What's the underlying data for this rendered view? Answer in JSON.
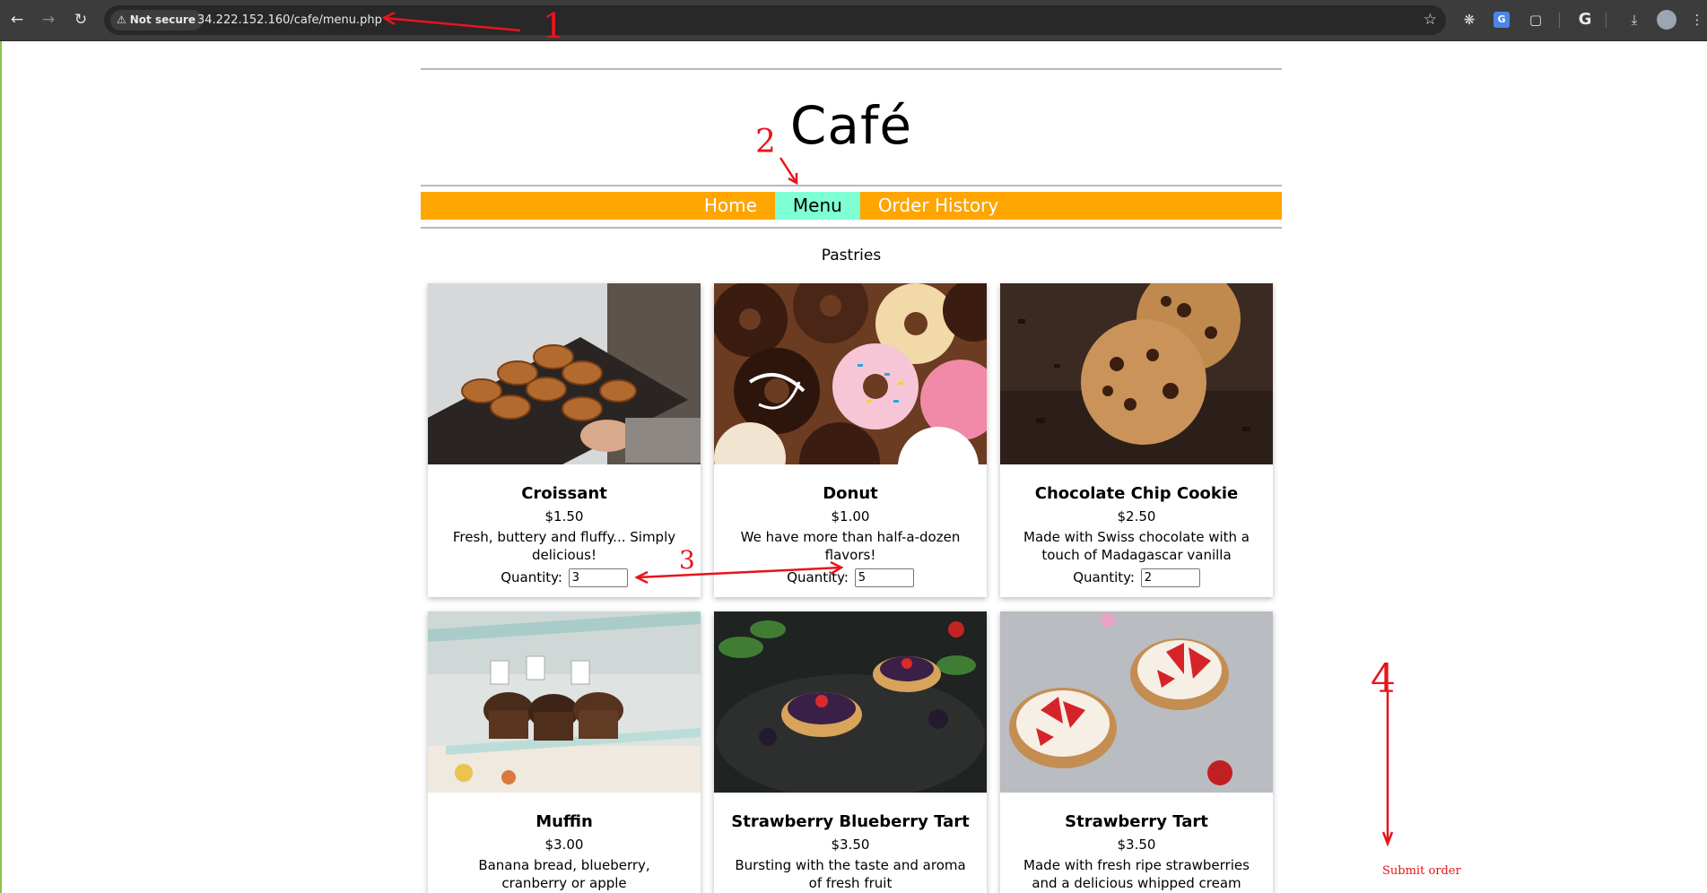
{
  "browser": {
    "back_icon": "arrow-left-icon",
    "forward_icon": "arrow-right-icon",
    "reload_icon": "reload-icon",
    "security_label": "Not secure",
    "url": "34.222.152.160/cafe/menu.php",
    "toolbar_icons": [
      "bookmark-star-icon",
      "extension-puzzle-icon",
      "translate-icon",
      "extensions-icon",
      "google-icon",
      "download-icon",
      "profile-avatar-icon",
      "kebab-menu-icon"
    ]
  },
  "site": {
    "title": "Café",
    "nav": [
      {
        "label": "Home",
        "active": false
      },
      {
        "label": "Menu",
        "active": true
      },
      {
        "label": "Order History",
        "active": false
      }
    ],
    "section_title": "Pastries"
  },
  "products": [
    {
      "name": "Croissant",
      "price": "$1.50",
      "description": "Fresh, buttery and fluffy... Simply delicious!",
      "quantity_label": "Quantity:",
      "quantity": "3"
    },
    {
      "name": "Donut",
      "price": "$1.00",
      "description": "We have more than half-a-dozen flavors!",
      "quantity_label": "Quantity:",
      "quantity": "5"
    },
    {
      "name": "Chocolate Chip Cookie",
      "price": "$2.50",
      "description": "Made with Swiss chocolate with a touch of Madagascar vanilla",
      "quantity_label": "Quantity:",
      "quantity": "2"
    },
    {
      "name": "Muffin",
      "price": "$3.00",
      "description": "Banana bread, blueberry, cranberry or apple"
    },
    {
      "name": "Strawberry Blueberry Tart",
      "price": "$3.50",
      "description": "Bursting with the taste and aroma of fresh fruit"
    },
    {
      "name": "Strawberry Tart",
      "price": "$3.50",
      "description": "Made with fresh ripe strawberries and a delicious whipped cream"
    }
  ],
  "annotations": {
    "marks": [
      "1",
      "2",
      "3",
      "4"
    ],
    "submit_label": "Submit order",
    "color": "#e8141b"
  },
  "colors": {
    "menu_bar": "#ffa500",
    "menu_active": "#7fffd4",
    "chrome": "#3c3c3c"
  }
}
